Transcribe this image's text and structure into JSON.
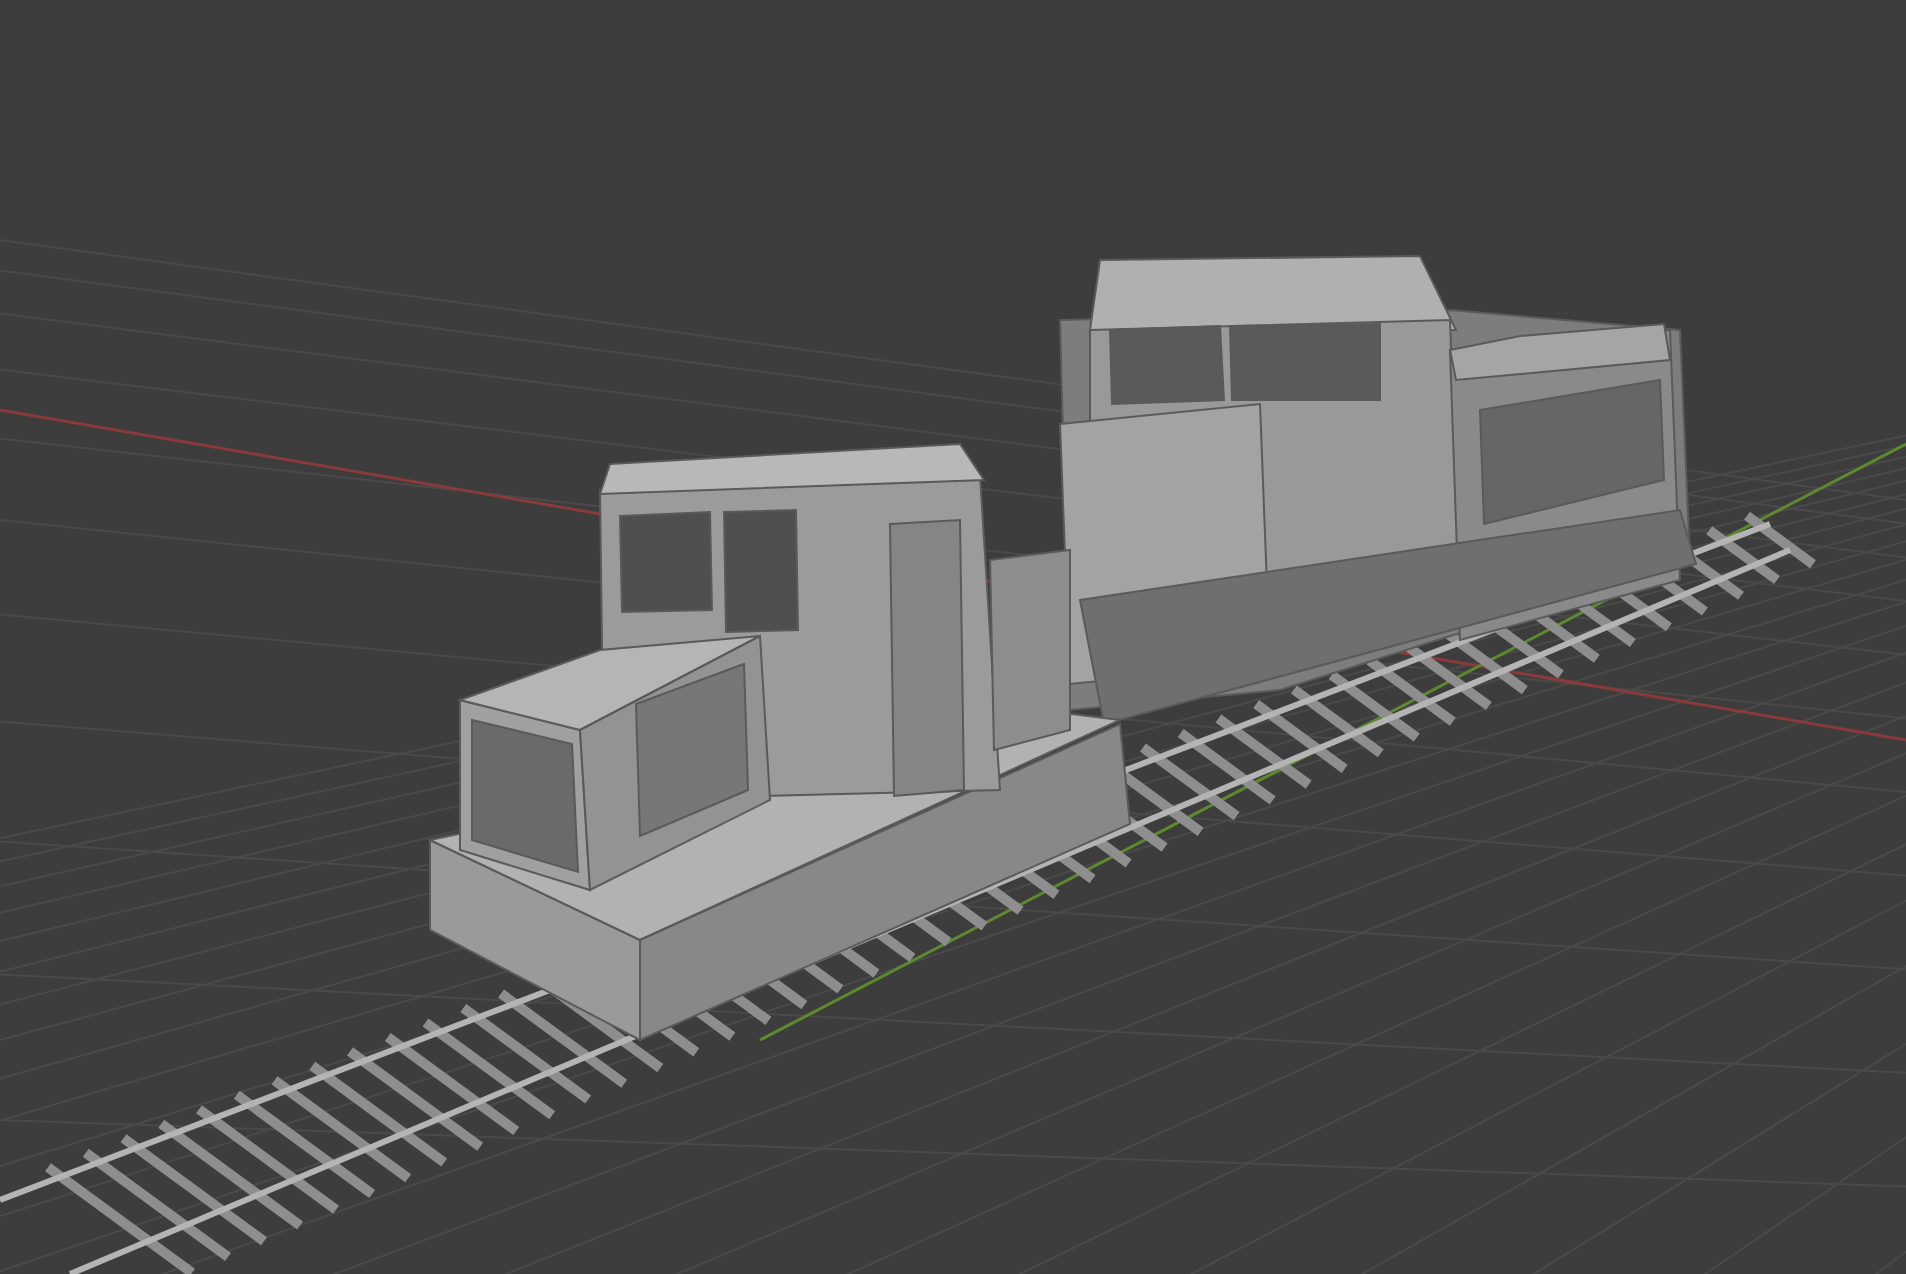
{
  "viewport": {
    "show_grid": true,
    "show_axes": true
  }
}
